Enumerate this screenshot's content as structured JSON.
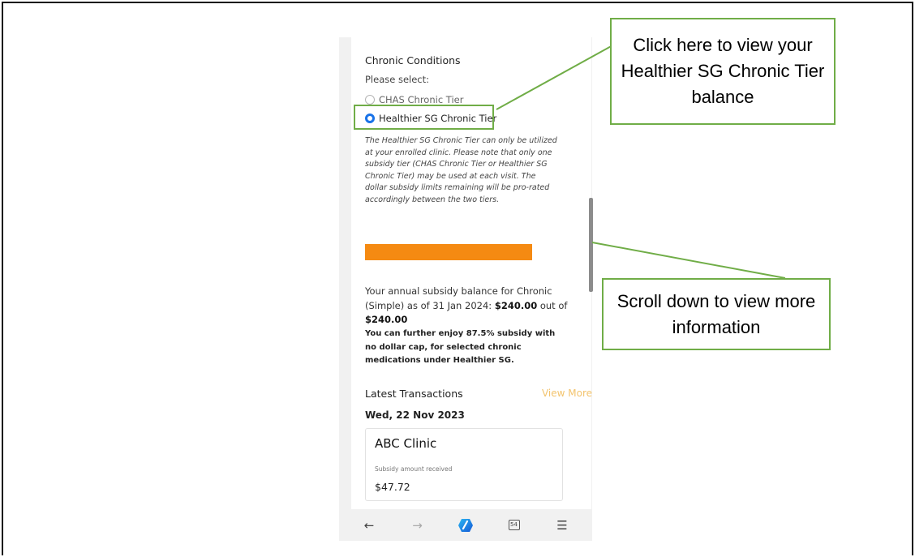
{
  "app": {
    "section_title": "Chronic Conditions",
    "prompt": "Please select:",
    "options": [
      {
        "label": "CHAS Chronic Tier",
        "selected": false
      },
      {
        "label": "Healthier SG Chronic Tier",
        "selected": true
      }
    ],
    "note": "The Healthier SG Chronic Tier can only be utilized at your enrolled clinic. Please note that only one subsidy tier (CHAS Chronic Tier or Healthier SG Chronic Tier) may be used at each visit. The dollar subsidy limits remaining will be pro-rated accordingly between the two tiers.",
    "balance_text_1": "Your annual subsidy balance for Chronic (Simple) as of 31 Jan 2024: ",
    "balance_amount": "$240.00",
    "balance_text_2": " out of ",
    "balance_total": "$240.00",
    "further_text": "You can further enjoy 87.5% subsidy with no dollar cap, for selected chronic medications under Healthier SG.",
    "latest_label": "Latest Transactions",
    "view_more_label": "View More",
    "transaction_date": "Wed, 22 Nov 2023",
    "transaction": {
      "clinic": "ABC Clinic",
      "subsidy_label": "Subsidy amount received",
      "amount": "$47.72"
    },
    "tab_count": "54"
  },
  "callouts": {
    "view_balance": "Click here to view your Healthier SG Chronic Tier balance",
    "scroll_down": "Scroll down to view more information"
  },
  "colors": {
    "highlight": "#70ad47",
    "bar": "#f58a12",
    "view_more": "#f3c46e",
    "radio_selected": "#1a73e8"
  }
}
